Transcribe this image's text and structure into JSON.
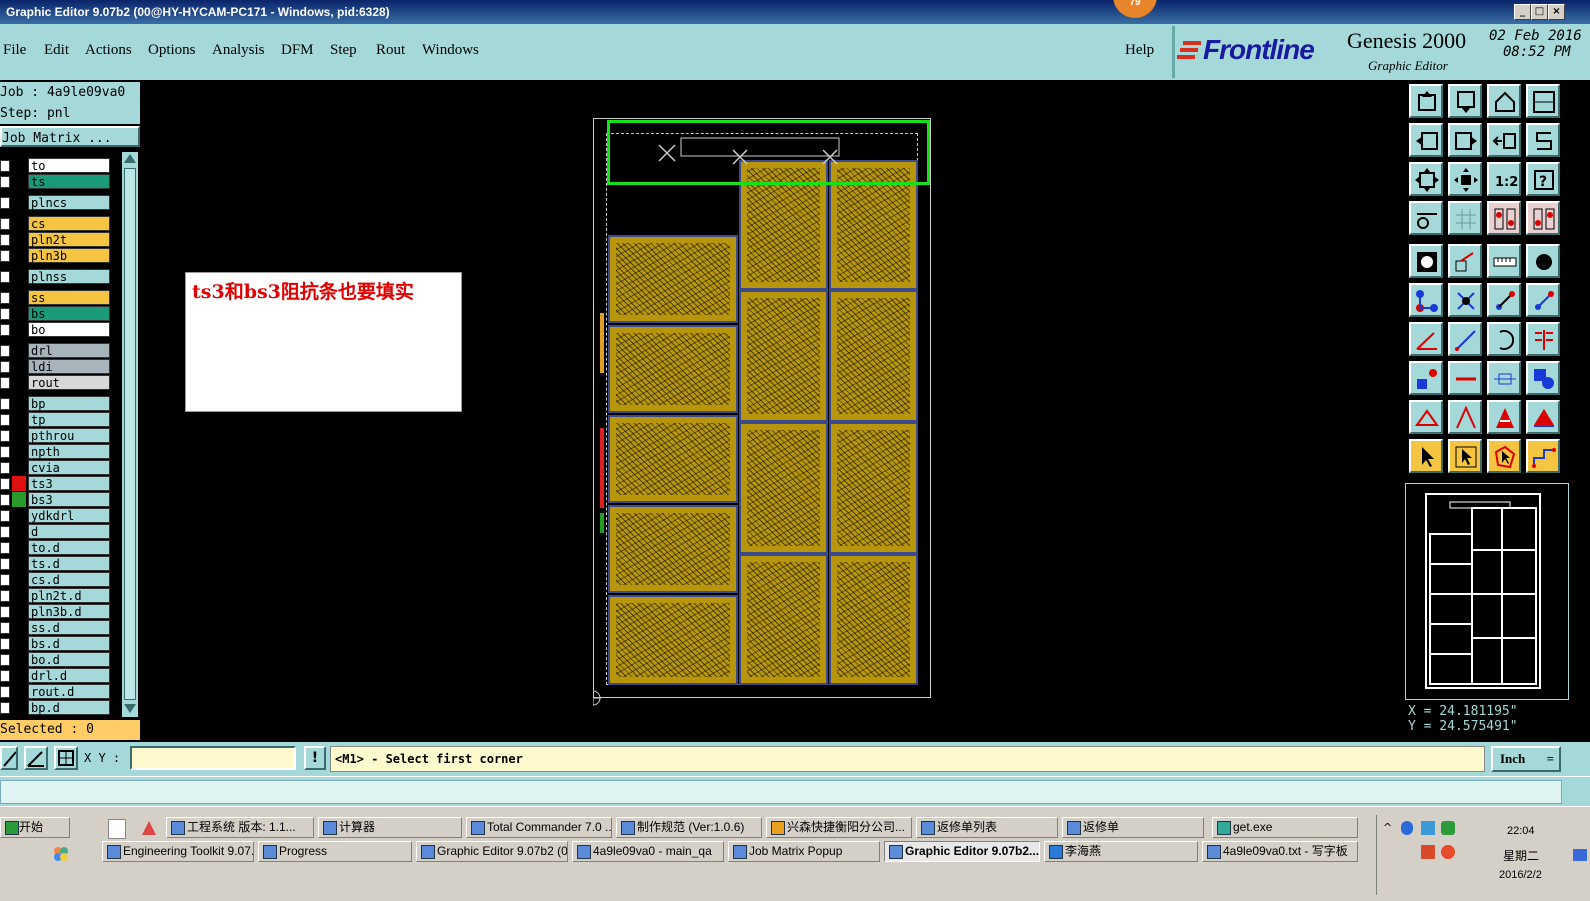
{
  "window": {
    "title": "Graphic Editor 9.07b2 (00@HY-HYCAM-PC171 - Windows, pid:6328)",
    "notification_count": "79"
  },
  "menu": [
    "File",
    "Edit",
    "Actions",
    "Options",
    "Analysis",
    "DFM",
    "Step",
    "Rout",
    "Windows"
  ],
  "help_label": "Help",
  "brand": {
    "logo": "Frontline",
    "product": "Genesis 2000",
    "subtitle": "Graphic Editor",
    "date": "02 Feb 2016",
    "time": "08:52 PM"
  },
  "job": {
    "job_line": "Job : 4a9le09va0",
    "step_line": "Step: pnl",
    "matrix_button": "Job Matrix ..."
  },
  "layers": [
    {
      "name": "to",
      "color": "#ffffff"
    },
    {
      "name": "ts",
      "color": "#1a9a78"
    },
    {
      "name": "plncs",
      "color": "#a5d8d8"
    },
    {
      "name": "cs",
      "color": "#f5c542"
    },
    {
      "name": "pln2t",
      "color": "#f5c542"
    },
    {
      "name": "pln3b",
      "color": "#f5c542"
    },
    {
      "name": "plnss",
      "color": "#a5d8d8"
    },
    {
      "name": "ss",
      "color": "#f5c542"
    },
    {
      "name": "bs",
      "color": "#1a9a78"
    },
    {
      "name": "bo",
      "color": "#ffffff"
    },
    {
      "name": "drl",
      "color": "#a8b4bc"
    },
    {
      "name": "ldi",
      "color": "#a8b4bc"
    },
    {
      "name": "rout",
      "color": "#d8d8d8"
    },
    {
      "name": "bp",
      "color": "#a5d8d8"
    },
    {
      "name": "tp",
      "color": "#a5d8d8"
    },
    {
      "name": "pthrou",
      "color": "#a5d8d8"
    },
    {
      "name": "npth",
      "color": "#a5d8d8"
    },
    {
      "name": "cvia",
      "color": "#a5d8d8"
    },
    {
      "name": "ts3",
      "color": "#a5d8d8",
      "swatch": "#e01010"
    },
    {
      "name": "bs3",
      "color": "#a5d8d8",
      "swatch": "#2a9a2a"
    },
    {
      "name": "ydkdrl",
      "color": "#a5d8d8"
    },
    {
      "name": "d",
      "color": "#a5d8d8"
    },
    {
      "name": "to.d",
      "color": "#a5d8d8"
    },
    {
      "name": "ts.d",
      "color": "#a5d8d8"
    },
    {
      "name": "cs.d",
      "color": "#a5d8d8"
    },
    {
      "name": "pln2t.d",
      "color": "#a5d8d8"
    },
    {
      "name": "pln3b.d",
      "color": "#a5d8d8"
    },
    {
      "name": "ss.d",
      "color": "#a5d8d8"
    },
    {
      "name": "bs.d",
      "color": "#a5d8d8"
    },
    {
      "name": "bo.d",
      "color": "#a5d8d8"
    },
    {
      "name": "drl.d",
      "color": "#a5d8d8"
    },
    {
      "name": "rout.d",
      "color": "#a5d8d8"
    },
    {
      "name": "bp.d",
      "color": "#a5d8d8"
    }
  ],
  "selected_label": "Selected : 0",
  "annotation": "ts3和bs3阻抗条也要填实",
  "coords": {
    "x": "X = 24.181195\"",
    "y": "Y = 24.575491\""
  },
  "command": {
    "xy_label": "X Y :",
    "xy_value": "",
    "prompt": "<M1> - Select first corner",
    "units": "Inch"
  },
  "taskbar": {
    "start": "开始",
    "row1": [
      "工程系统  版本: 1.1...",
      "计算器",
      "Total Commander 7.0 ...",
      "制作规范 (Ver:1.0.6)",
      "兴森快捷衡阳分公司...",
      "返修单列表",
      "返修单",
      "get.exe"
    ],
    "row2": [
      "Engineering Toolkit 9.07...",
      "Progress",
      "Graphic Editor 9.07b2 (0...",
      "4a9le09va0 - main_qa",
      "Job Matrix Popup",
      "Graphic Editor 9.07b2...",
      "李海燕",
      "4a9le09va0.txt - 写字板"
    ],
    "clock_time": "22:04",
    "clock_day": "星期二",
    "clock_date": "2016/2/2"
  }
}
